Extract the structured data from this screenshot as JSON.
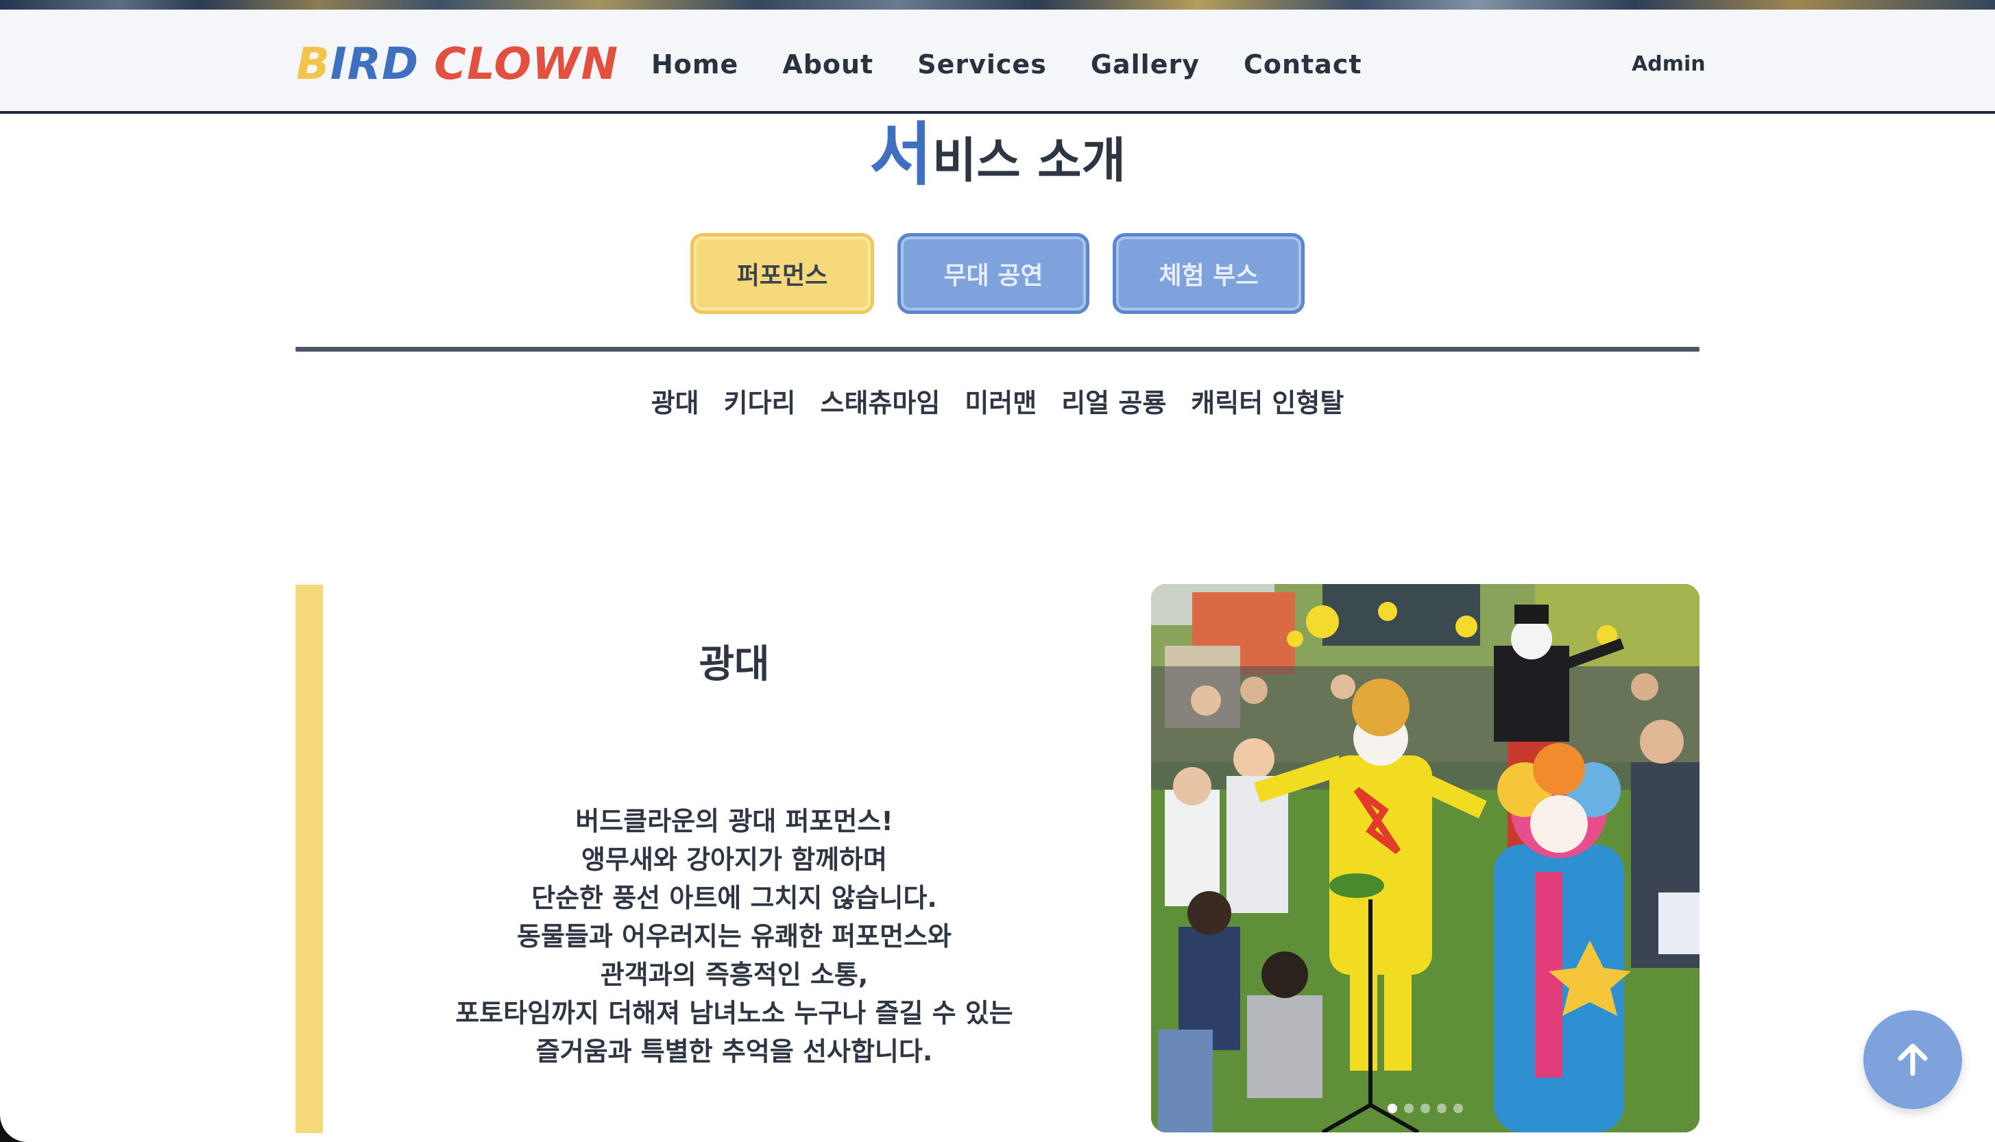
{
  "brand": {
    "logo_b": "B",
    "logo_ird": "IRD",
    "logo_clown": "CLOWN"
  },
  "nav": {
    "links": [
      "Home",
      "About",
      "Services",
      "Gallery",
      "Contact"
    ],
    "admin": "Admin"
  },
  "section": {
    "title_first": "서",
    "title_rest": "비스 소개"
  },
  "tabs": [
    {
      "label": "퍼포먼스",
      "active": true
    },
    {
      "label": "무대 공연",
      "active": false
    },
    {
      "label": "체험 부스",
      "active": false
    }
  ],
  "subtabs": [
    "광대",
    "키다리",
    "스태츄마임",
    "미러맨",
    "리얼 공룡",
    "캐릭터 인형탈"
  ],
  "content": {
    "title": "광대",
    "lines": [
      "버드클라운의 광대 퍼포먼스!",
      "앵무새와 강아지가 함께하며",
      "단순한 풍선 아트에 그치지 않습니다.",
      "동물들과 어우러지는 유쾌한 퍼포먼스와",
      "관객과의 즉흥적인 소통,",
      "포토타임까지 더해져 남녀노소 누구나 즐길 수 있는",
      "즐거움과 특별한 추억을 선사합니다."
    ]
  },
  "carousel": {
    "slide_count": 5,
    "active_index": 0
  },
  "colors": {
    "accent_yellow": "#f6d97a",
    "accent_blue": "#7ea3dc",
    "logo_red": "#e4503f",
    "logo_blue": "#3f6fc0",
    "text_dark": "#2e3543"
  },
  "icons": {
    "scroll_top": "arrow-up-icon"
  }
}
